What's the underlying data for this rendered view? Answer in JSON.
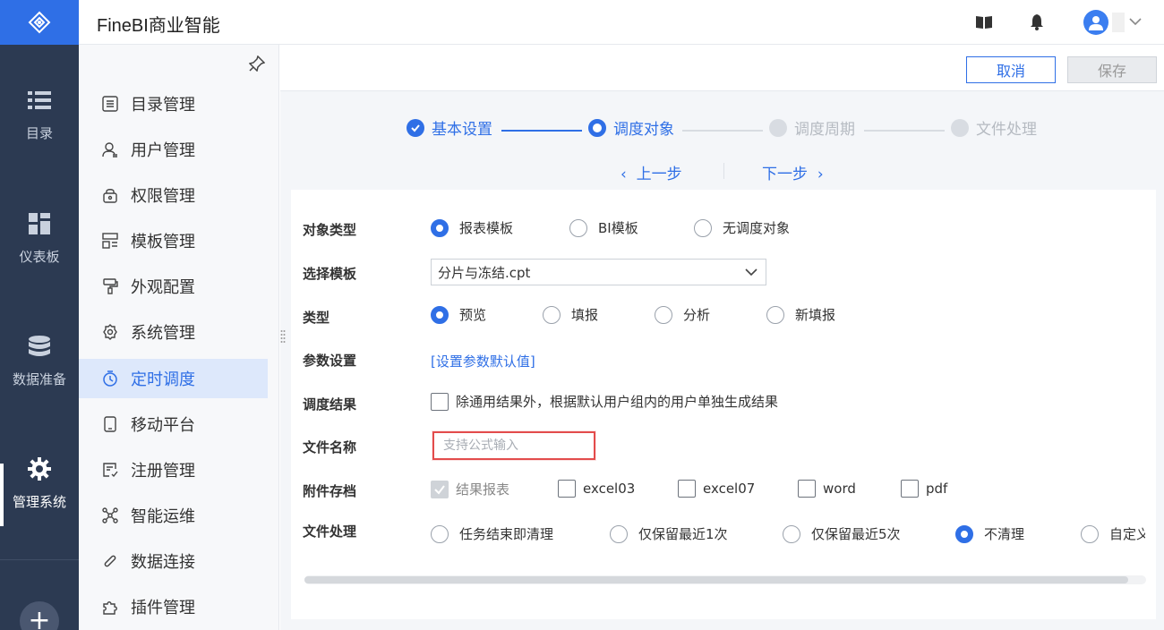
{
  "app": {
    "title": "FineBI商业智能"
  },
  "rail": {
    "items": [
      {
        "label": "目录",
        "icon": "list-icon"
      },
      {
        "label": "仪表板",
        "icon": "dashboard-icon"
      },
      {
        "label": "数据准备",
        "icon": "database-icon"
      },
      {
        "label": "管理系统",
        "icon": "gear-icon",
        "active": true
      }
    ],
    "add": "+"
  },
  "menu": {
    "items": [
      {
        "label": "目录管理",
        "icon": "catalog-icon"
      },
      {
        "label": "用户管理",
        "icon": "user-icon"
      },
      {
        "label": "权限管理",
        "icon": "lock-icon"
      },
      {
        "label": "模板管理",
        "icon": "template-icon"
      },
      {
        "label": "外观配置",
        "icon": "brush-icon"
      },
      {
        "label": "系统管理",
        "icon": "settings-icon"
      },
      {
        "label": "定时调度",
        "icon": "timer-icon",
        "active": true
      },
      {
        "label": "移动平台",
        "icon": "mobile-icon"
      },
      {
        "label": "注册管理",
        "icon": "register-icon"
      },
      {
        "label": "智能运维",
        "icon": "ops-icon"
      },
      {
        "label": "数据连接",
        "icon": "link-icon"
      },
      {
        "label": "插件管理",
        "icon": "plugin-icon"
      }
    ]
  },
  "actions": {
    "cancel": "取消",
    "save": "保存"
  },
  "steps": [
    {
      "label": "基本设置",
      "state": "done"
    },
    {
      "label": "调度对象",
      "state": "current"
    },
    {
      "label": "调度周期",
      "state": "pending"
    },
    {
      "label": "文件处理",
      "state": "pending"
    }
  ],
  "nav": {
    "prev": "上一步",
    "next": "下一步"
  },
  "form": {
    "object_type": {
      "label": "对象类型",
      "options": [
        "报表模板",
        "BI模板",
        "无调度对象"
      ],
      "selected": 0
    },
    "template": {
      "label": "选择模板",
      "value": "分片与冻结.cpt"
    },
    "type": {
      "label": "类型",
      "options": [
        "预览",
        "填报",
        "分析",
        "新填报"
      ],
      "selected": 0
    },
    "params": {
      "label": "参数设置",
      "link": "[设置参数默认值]"
    },
    "result": {
      "label": "调度结果",
      "checkbox": "除通用结果外，根据默认用户组内的用户单独生成结果"
    },
    "filename": {
      "label": "文件名称",
      "placeholder": "支持公式输入",
      "value": ""
    },
    "attachment": {
      "label": "附件存档",
      "options": [
        "结果报表",
        "excel03",
        "excel07",
        "word",
        "pdf"
      ]
    },
    "file_handling": {
      "label": "文件处理",
      "options": [
        "任务结束即清理",
        "仅保留最近1次",
        "仅保留最近5次",
        "不清理",
        "自定义"
      ],
      "selected": 3
    }
  },
  "colors": {
    "brand": "#2f6fe6",
    "rail": "#2c3a52",
    "highlight": "#e34c4c"
  }
}
